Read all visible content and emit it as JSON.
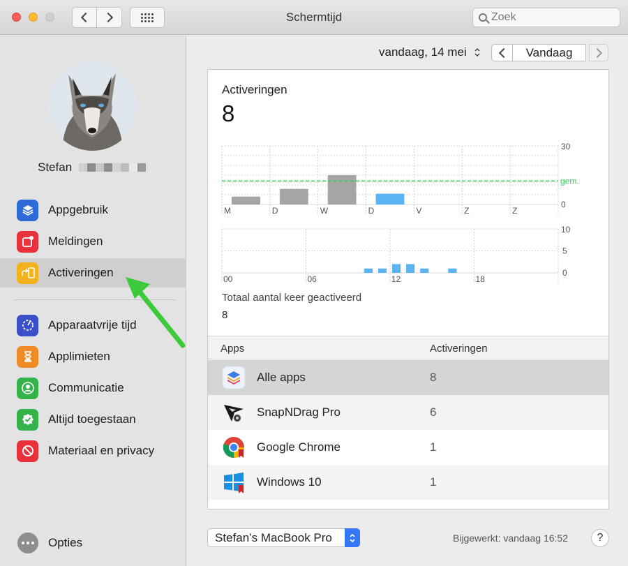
{
  "window": {
    "title": "Schermtijd"
  },
  "search": {
    "placeholder": "Zoek"
  },
  "user": {
    "name": "Stefan"
  },
  "sidebar": {
    "items": [
      {
        "label": "Appgebruik",
        "icon": "layers-icon",
        "color": "#2f6bd8"
      },
      {
        "label": "Meldingen",
        "icon": "notification-icon",
        "color": "#e8313a"
      },
      {
        "label": "Activeringen",
        "icon": "pickup-icon",
        "color": "#f2b21b"
      },
      {
        "label": "Apparaatvrije tijd",
        "icon": "downtime-icon",
        "color": "#3a4fc8"
      },
      {
        "label": "Applimieten",
        "icon": "hourglass-icon",
        "color": "#f08a24"
      },
      {
        "label": "Communicatie",
        "icon": "contact-icon",
        "color": "#33b34a"
      },
      {
        "label": "Altijd toegestaan",
        "icon": "checkmark-icon",
        "color": "#33b34a"
      },
      {
        "label": "Materiaal en privacy",
        "icon": "restriction-icon",
        "color": "#e8313a"
      }
    ],
    "options_label": "Opties"
  },
  "datebar": {
    "date": "vandaag, 14 mei",
    "today_button": "Vandaag"
  },
  "panel": {
    "title": "Activeringen",
    "count": "8",
    "total_label": "Totaal aantal keer geactiveerd",
    "total_value": "8"
  },
  "chart_data": [
    {
      "type": "bar",
      "categories": [
        "M",
        "D",
        "W",
        "D",
        "V",
        "Z",
        "Z"
      ],
      "values": [
        4,
        8,
        15,
        5.5,
        0,
        0,
        0
      ],
      "average": 12,
      "average_label": "gem.",
      "ylim": [
        0,
        30
      ],
      "yticks": [
        "30",
        "0"
      ],
      "highlight_index": 3,
      "colors": {
        "default": "#a5a5a5",
        "highlight": "#5ab3f3",
        "average": "#34c759"
      }
    },
    {
      "type": "bar",
      "x_ticks": [
        "00",
        "06",
        "12",
        "18"
      ],
      "hours": [
        10,
        11,
        12,
        13,
        14,
        16
      ],
      "values": [
        1,
        1,
        2,
        2,
        1,
        1
      ],
      "ylim": [
        0,
        10
      ],
      "yticks": [
        "10",
        "5",
        "0"
      ],
      "colors": {
        "bar": "#5ab3f3"
      }
    }
  ],
  "table": {
    "headers": {
      "apps": "Apps",
      "activations": "Activeringen"
    },
    "rows": [
      {
        "name": "Alle apps",
        "value": "8",
        "icon": "all-apps-icon"
      },
      {
        "name": "SnapNDrag Pro",
        "value": "6",
        "icon": "snapndrag-icon"
      },
      {
        "name": "Google Chrome",
        "value": "1",
        "icon": "chrome-icon"
      },
      {
        "name": "Windows 10",
        "value": "1",
        "icon": "windows-icon"
      }
    ]
  },
  "footer": {
    "device": "Stefan’s MacBook Pro",
    "updated": "Bijgewerkt: vandaag 16:52",
    "help": "?"
  }
}
